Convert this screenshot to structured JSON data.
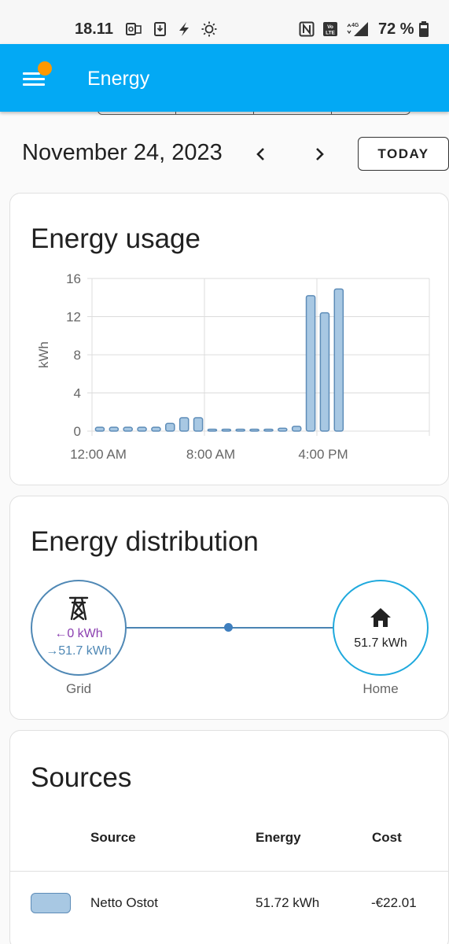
{
  "status_bar": {
    "time": "18.11",
    "battery_percent": "72 %",
    "icons": [
      "outlook-icon",
      "download-icon",
      "flash-icon",
      "sun-icon",
      "nfc-icon",
      "volte-icon",
      "signal-4g-icon",
      "battery-icon"
    ]
  },
  "app_bar": {
    "title": "Energy",
    "menu_icon": "menu-icon",
    "notification_badge_color": "#ff9800",
    "background_color": "#03a9f4"
  },
  "date_nav": {
    "date": "November 24, 2023",
    "prev_icon": "chevron-left-icon",
    "next_icon": "chevron-right-icon",
    "today_label": "TODAY"
  },
  "usage_card": {
    "title": "Energy usage",
    "chart_data": {
      "type": "bar",
      "title": "Energy usage",
      "xlabel": "",
      "ylabel": "kWh",
      "ylim": [
        0,
        16
      ],
      "yticks": [
        "0",
        "4",
        "8",
        "12",
        "16"
      ],
      "xticks": [
        "12:00 AM",
        "8:00 AM",
        "4:00 PM"
      ],
      "grid": true,
      "bar_color": "#a8c8e3",
      "bar_edge_color": "#5d8cb8",
      "categories": [
        "0",
        "1",
        "2",
        "3",
        "4",
        "5",
        "6",
        "7",
        "8",
        "9",
        "10",
        "11",
        "12",
        "13",
        "14",
        "15",
        "16",
        "17",
        "18",
        "19",
        "20",
        "21",
        "22",
        "23"
      ],
      "values": [
        0.4,
        0.4,
        0.4,
        0.4,
        0.4,
        0.8,
        1.4,
        1.4,
        0.2,
        0.2,
        0.2,
        0.2,
        0.2,
        0.3,
        0.5,
        14.2,
        12.4,
        14.9,
        0,
        0,
        0,
        0,
        0,
        0
      ]
    }
  },
  "distribution_card": {
    "title": "Energy distribution",
    "grid": {
      "icon": "transmission-tower-icon",
      "from_grid": "0 kWh",
      "to_grid": "51.7 kWh",
      "label": "Grid"
    },
    "home": {
      "icon": "home-icon",
      "value": "51.7 kWh",
      "label": "Home"
    }
  },
  "sources_card": {
    "title": "Sources",
    "columns": {
      "source": "Source",
      "energy": "Energy",
      "cost": "Cost"
    },
    "rows": [
      {
        "source": "Netto Ostot",
        "energy": "51.72 kWh",
        "cost": "-€22.01",
        "color": "#a8c8e3"
      }
    ]
  }
}
